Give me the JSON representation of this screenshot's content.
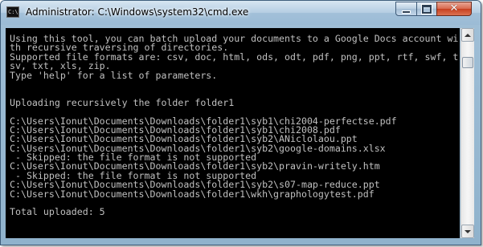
{
  "window": {
    "title": "Administrator: C:\\Windows\\system32\\cmd.exe",
    "icon": "cmd-icon",
    "icon_text": "C:\\"
  },
  "controls": {
    "minimize": "minimize-icon",
    "maximize": "maximize-icon",
    "close": "close-icon",
    "close_glyph": "✕"
  },
  "console": {
    "lines": [
      "Using this tool, you can batch upload your documents to a Google Docs account wi",
      "th recursive traversing of directories.",
      "Supported file formats are: csv, doc, html, ods, odt, pdf, png, ppt, rtf, swf, t",
      "sv, txt, xls, zip.",
      "Type 'help' for a list of parameters.",
      "",
      "",
      "Uploading recursively the folder folder1",
      "",
      "C:\\Users\\Ionut\\Documents\\Downloads\\folder1\\syb1\\chi2004-perfectse.pdf",
      "C:\\Users\\Ionut\\Documents\\Downloads\\folder1\\syb1\\chi2008.pdf",
      "C:\\Users\\Ionut\\Documents\\Downloads\\folder1\\syb2\\ANiclolaou.ppt",
      "C:\\Users\\Ionut\\Documents\\Downloads\\folder1\\syb2\\google-domains.xlsx",
      " - Skipped: the file format is not supported",
      "C:\\Users\\Ionut\\Documents\\Downloads\\folder1\\syb2\\pravin-writely.htm",
      " - Skipped: the file format is not supported",
      "C:\\Users\\Ionut\\Documents\\Downloads\\folder1\\syb2\\s07-map-reduce.ppt",
      "C:\\Users\\Ionut\\Documents\\Downloads\\folder1\\wkh\\graphologytest.pdf",
      "",
      "Total uploaded: 5"
    ]
  }
}
